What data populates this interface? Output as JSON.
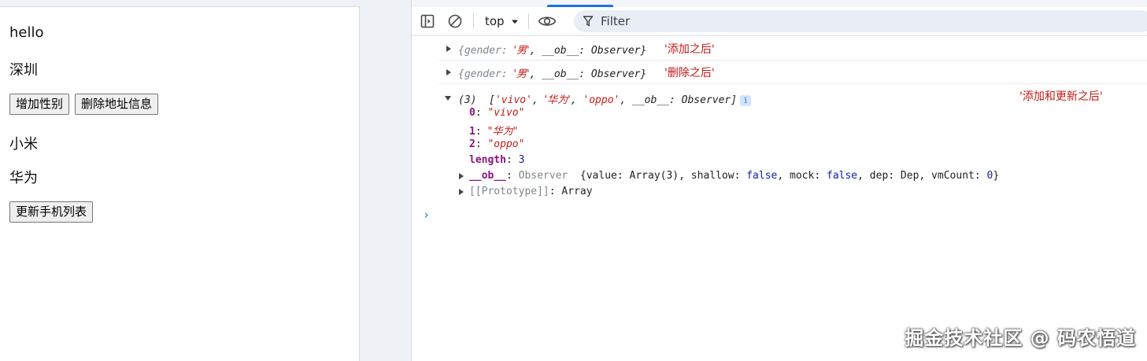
{
  "page": {
    "hello": "hello",
    "city": "深圳",
    "btn_add_gender": "增加性别",
    "btn_delete_address": "删除地址信息",
    "phone1": "小米",
    "phone2": "华为",
    "btn_update_phones": "更新手机列表"
  },
  "devtools": {
    "context": "top",
    "filter_placeholder": "Filter"
  },
  "console": {
    "log1": {
      "obj_open": "{gender: ",
      "gender_val": "'男'",
      "mid": ", __ob__: Observer}",
      "msg": "'添加之后'"
    },
    "log2": {
      "obj_open": "{gender: ",
      "gender_val": "'男'",
      "mid": ", __ob__: Observer}",
      "msg": "'删除之后'"
    },
    "log3": {
      "count": "(3)",
      "arr_open": "[",
      "v0": "'vivo'",
      "v1": "'华为'",
      "v2": "'oppo'",
      "arr_tail": ", __ob__: Observer]",
      "badge": "i",
      "msg": "'添加和更新之后'",
      "item0_key": "0",
      "item0_val": "\"vivo\"",
      "item1_key": "1",
      "item1_val": "\"华为\"",
      "item2_key": "2",
      "item2_val": "\"oppo\"",
      "length_key": "length",
      "length_val": "3",
      "ob_key": "__ob__",
      "ob_type": "Observer",
      "ob_detail_a": "{value: Array(3), shallow: ",
      "ob_false1": "false",
      "ob_detail_b": ", mock: ",
      "ob_false2": "false",
      "ob_detail_c": ", dep: Dep, vmCount: ",
      "ob_zero": "0",
      "ob_close": "}",
      "proto_key": "[[Prototype]]",
      "proto_val": "Array"
    },
    "prompt": "›"
  },
  "watermark": "掘金技术社区 @ 码农悟道",
  "colors": {
    "string": "#c41a16",
    "key": "#881280",
    "number": "#1a1aa6",
    "accent": "#1a73e8"
  }
}
